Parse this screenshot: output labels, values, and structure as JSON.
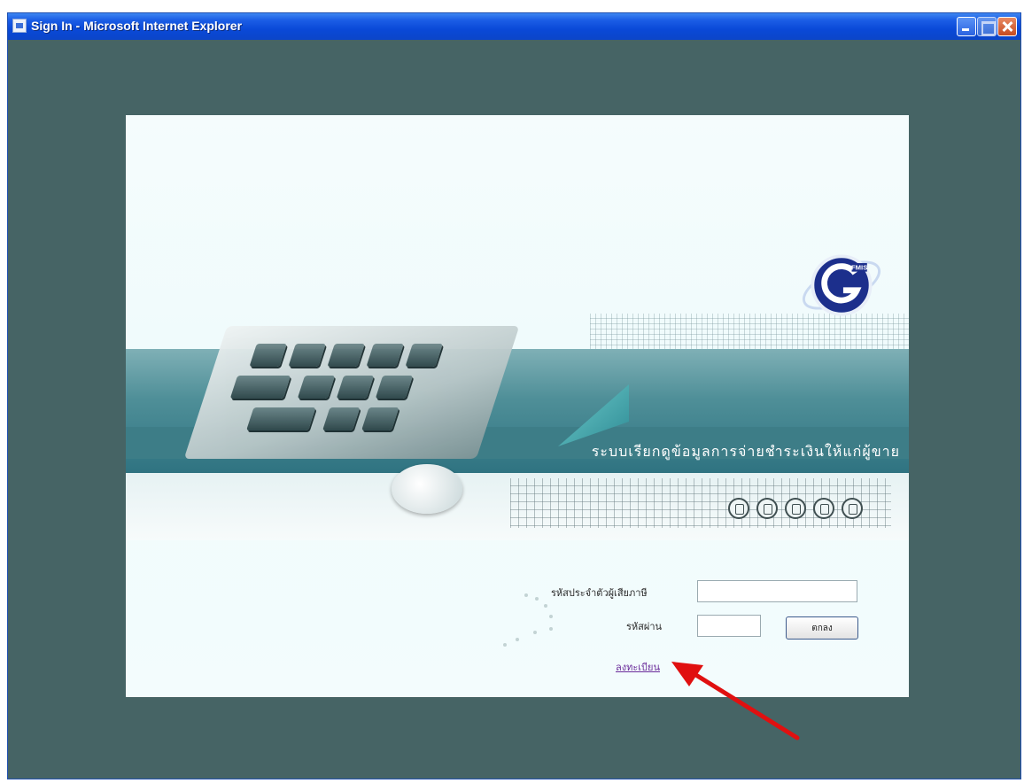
{
  "window": {
    "title": "Sign In - Microsoft Internet Explorer"
  },
  "banner": {
    "subtitle": "ระบบเรียกดูข้อมูลการจ่ายชำระเงินให้แก่ผู้ขาย"
  },
  "form": {
    "id_label": "รหัสประจำตัวผู้เสียภาษี",
    "id_value": "",
    "password_label": "รหัสผ่าน",
    "password_value": "",
    "ok_button": "ตกลง",
    "register_link": "ลงทะเบียน"
  },
  "icons": [
    "globe-icon",
    "document-icon",
    "printer-icon",
    "hand-pointer-icon",
    "power-icon"
  ],
  "colors": {
    "desktop": "#466465",
    "titlebar": "#0a49d8",
    "link": "#6a2b9a",
    "arrow": "#e01010"
  }
}
